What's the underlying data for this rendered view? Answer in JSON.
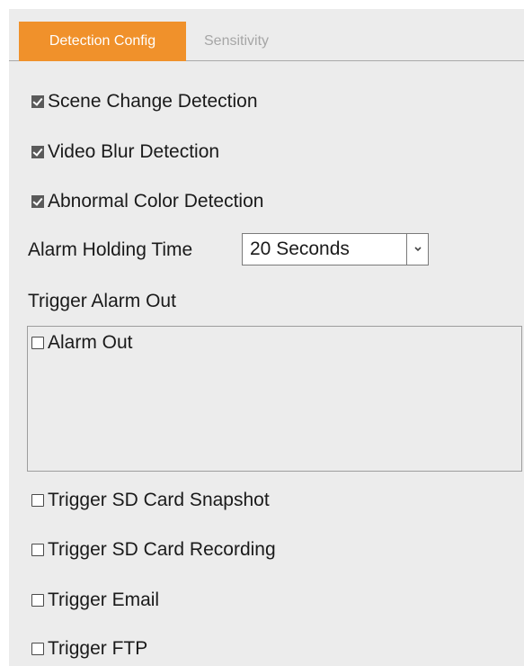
{
  "tabs": {
    "detection_config": "Detection Config",
    "sensitivity": "Sensitivity"
  },
  "detections": [
    {
      "label": "Scene Change Detection",
      "checked": true
    },
    {
      "label": "Video Blur Detection",
      "checked": true
    },
    {
      "label": "Abnormal Color Detection",
      "checked": true
    }
  ],
  "alarm_holding_time": {
    "label": "Alarm Holding Time",
    "selected_value": "20 Seconds"
  },
  "trigger_alarm_out": {
    "label": "Trigger Alarm Out",
    "alarm_out_label": "Alarm Out",
    "alarm_out_checked": false
  },
  "triggers": [
    {
      "label": "Trigger SD Card Snapshot",
      "checked": false
    },
    {
      "label": "Trigger SD Card Recording",
      "checked": false
    },
    {
      "label": "Trigger Email",
      "checked": false
    },
    {
      "label": "Trigger FTP",
      "checked": false
    }
  ],
  "colors": {
    "tab_active_bg": "#f0912b",
    "panel_bg": "#ececec",
    "tab_inactive_text": "#a6a6a6"
  }
}
